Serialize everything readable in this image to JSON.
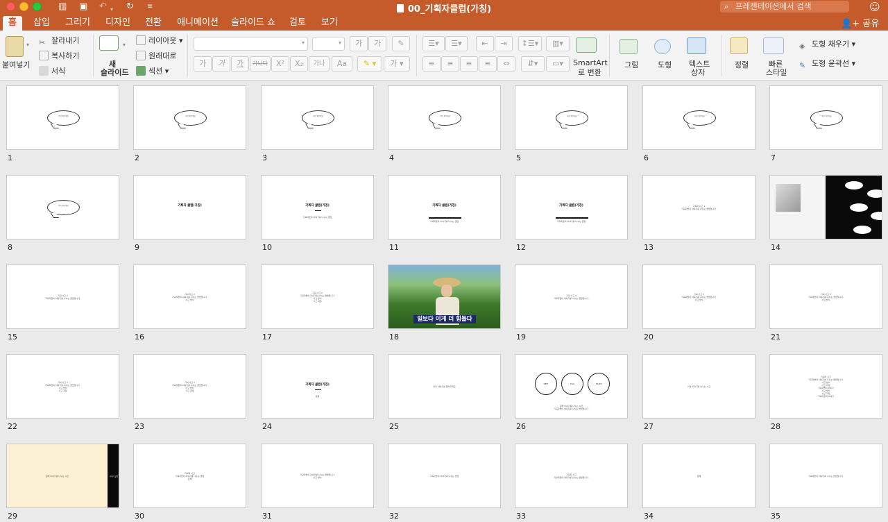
{
  "window": {
    "title": "00_기획자클럽(가칭)",
    "search_placeholder": "프레젠테이션에서 검색",
    "share_label": "공유"
  },
  "tabs": [
    {
      "label": "홈",
      "active": true
    },
    {
      "label": "삽입"
    },
    {
      "label": "그리기"
    },
    {
      "label": "디자인"
    },
    {
      "label": "전환"
    },
    {
      "label": "애니메이션"
    },
    {
      "label": "슬라이드 쇼"
    },
    {
      "label": "검토"
    },
    {
      "label": "보기"
    }
  ],
  "ribbon": {
    "paste": "붙여넣기",
    "cut": "잘라내기",
    "copy": "복사하기",
    "format": "서식",
    "new_slide_line1": "새",
    "new_slide_line2": "슬라이드",
    "layout": "레이아웃",
    "reset": "원래대로",
    "section": "섹션",
    "font_grow": "가",
    "font_shrink": "가",
    "bold": "가",
    "italic": "가",
    "underline": "가",
    "strike": "가나다",
    "superscript": "X²",
    "subscript": "X₂",
    "spacing": "가나",
    "case": "Aa",
    "font_color": "가",
    "smartart_line1": "SmartArt",
    "smartart_line2": "로 변환",
    "picture": "그림",
    "shapes": "도형",
    "textbox_line1": "텍스트",
    "textbox_line2": "상자",
    "arrange": "정렬",
    "quickstyle_line1": "빠른",
    "quickstyle_line2": "스타일",
    "shape_fill": "도형 채우기",
    "shape_outline": "도형 윤곽선"
  },
  "slides": [
    {
      "num": "1",
      "kind": "bubble",
      "text": "여기 써주세요"
    },
    {
      "num": "2",
      "kind": "bubble",
      "text": "여기 써주세요"
    },
    {
      "num": "3",
      "kind": "bubble",
      "text": "여기 써주세요"
    },
    {
      "num": "4",
      "kind": "bubble",
      "text": "여기 써주세요"
    },
    {
      "num": "5",
      "kind": "bubble",
      "text": "여기 써주세요"
    },
    {
      "num": "6",
      "kind": "bubble",
      "text": "여기 써주세요"
    },
    {
      "num": "7",
      "kind": "bubble",
      "text": "여기 써주세요"
    },
    {
      "num": "8",
      "kind": "bubble",
      "text": "여기 써주세요"
    },
    {
      "num": "9",
      "kind": "title",
      "title": "기획자 클럽(가칭)"
    },
    {
      "num": "10",
      "kind": "title-sub",
      "title": "기획자 클럽(가칭)",
      "sub": "기획자들의 이야기를 나누는 클럽"
    },
    {
      "num": "11",
      "kind": "title-bar",
      "title": "기획자 클럽(가칭)",
      "sub": "기획자들의 이야기를 나누는 클럽"
    },
    {
      "num": "12",
      "kind": "title-bar",
      "title": "기획자 클럽(가칭)",
      "sub": "기획자들의 이야기를 나누는 클럽"
    },
    {
      "num": "13",
      "kind": "text",
      "lines": [
        "기획자 사고 1",
        "기획자들의 이야기를 나누는 클럽입니다."
      ]
    },
    {
      "num": "14",
      "kind": "image-dark"
    },
    {
      "num": "15",
      "kind": "text",
      "lines": [
        "기획 사고 2",
        "기획자들의 이야기를 나누는 클럽입니다."
      ]
    },
    {
      "num": "16",
      "kind": "text",
      "lines": [
        "기획 사고 2",
        "기획자들의 이야기를 나누는 클럽입니다.",
        "사고 방식"
      ]
    },
    {
      "num": "17",
      "kind": "text",
      "lines": [
        "기획 사고 2",
        "기획자들의 이야기를 나누는 클럽입니다.",
        "사고 방식",
        "사고 과정"
      ]
    },
    {
      "num": "18",
      "kind": "photo",
      "caption": "일보다 이게 더 힘들다"
    },
    {
      "num": "19",
      "kind": "text",
      "lines": [
        "기획 사고 3",
        "기획자들의 이야기를 나누는 클럽입니다."
      ]
    },
    {
      "num": "20",
      "kind": "text",
      "lines": [
        "기획 사고 3",
        "기획자들의 이야기를 나누는 클럽입니다.",
        "사고 방식"
      ]
    },
    {
      "num": "21",
      "kind": "text",
      "lines": [
        "기획 사고 3",
        "기획자들의 이야기를 나누는 클럽입니다.",
        "사고 방식"
      ]
    },
    {
      "num": "22",
      "kind": "text",
      "lines": [
        "기획 사고 3",
        "기획자들의 이야기를 나누는 클럽입니다.",
        "사고 방식",
        "사고 과정"
      ]
    },
    {
      "num": "23",
      "kind": "text",
      "lines": [
        "기획 사고 3",
        "기획자들의 이야기를 나누는 클럽입니다.",
        "사고 방식",
        "사고 과정"
      ]
    },
    {
      "num": "24",
      "kind": "title-sub",
      "title": "기획자 클럽(가칭)",
      "sub": "함께"
    },
    {
      "num": "25",
      "kind": "text",
      "lines": [
        "우리 이야기를 들어주세요"
      ]
    },
    {
      "num": "26",
      "kind": "circles",
      "circles": [
        "MEET",
        "TALK",
        "SHARE"
      ],
      "lines": [
        "함께 이야기를 나누는 시간",
        "기획자들의 이야기를 나누는 클럽입니다."
      ]
    },
    {
      "num": "27",
      "kind": "text",
      "lines": [
        "기획 이야기를 나누는 시간"
      ]
    },
    {
      "num": "28",
      "kind": "text",
      "lines": [
        "기획자 사고",
        "기획자들의 이야기를 나누는 클럽입니다.",
        "사고 방식",
        "사고 과정",
        "기획자들의 이야기",
        "사고 방식",
        "사고 과정",
        "기획자들의 이야기"
      ]
    },
    {
      "num": "29",
      "kind": "cream",
      "text": "함께 이야기를 나누는 시간",
      "side": "기획자 클럽"
    },
    {
      "num": "30",
      "kind": "text",
      "lines": [
        "기획자 사고",
        "기획자들의 이야기를 나누는 클럽",
        "함께"
      ]
    },
    {
      "num": "31",
      "kind": "text",
      "lines": [
        "기획자들의 이야기를 나누는 클럽입니다.",
        "사고 방식"
      ]
    },
    {
      "num": "32",
      "kind": "text",
      "lines": [
        "기획자들의 이야기를 나누는 클럽"
      ]
    },
    {
      "num": "33",
      "kind": "text",
      "lines": [
        "기획자 사고",
        "기획자들의 이야기를 나누는 클럽입니다."
      ]
    },
    {
      "num": "34",
      "kind": "text",
      "lines": [
        "함께"
      ]
    },
    {
      "num": "35",
      "kind": "text",
      "lines": [
        "기획자들의 이야기를 나누는 클럽입니다."
      ]
    }
  ]
}
